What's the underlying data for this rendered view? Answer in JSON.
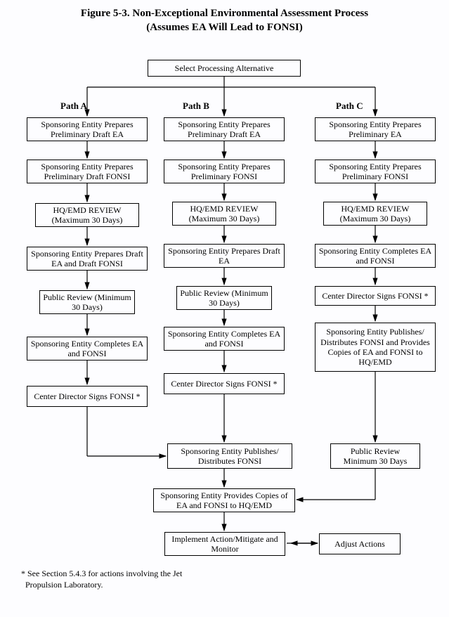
{
  "title_line1": "Figure 5-3.  Non-Exceptional Environmental Assessment Process",
  "title_line2": "(Assumes EA Will Lead to FONSI)",
  "top_box": "Select Processing Alternative",
  "pathA_label": "Path A",
  "pathB_label": "Path B",
  "pathC_label": "Path C",
  "A1": "Sponsoring Entity Prepares Preliminary Draft EA",
  "A2": "Sponsoring Entity Prepares Preliminary Draft FONSI",
  "A3": "HQ/EMD REVIEW (Maximum 30 Days)",
  "A4": "Sponsoring Entity Prepares Draft EA and Draft FONSI",
  "A5": "Public Review (Minimum 30 Days)",
  "A6": "Sponsoring Entity Completes EA and FONSI",
  "A7": "Center Director Signs FONSI *",
  "B1": "Sponsoring Entity Prepares Preliminary Draft EA",
  "B2": "Sponsoring Entity Prepares Preliminary FONSI",
  "B3": "HQ/EMD REVIEW (Maximum 30 Days)",
  "B4": "Sponsoring Entity Prepares Draft EA",
  "B5": "Public Review (Minimum 30 Days)",
  "B6": "Sponsoring Entity Completes EA and FONSI",
  "B7": "Center Director Signs FONSI *",
  "B8": "Sponsoring Entity Publishes/ Distributes FONSI",
  "B9": "Sponsoring Entity Provides Copies of EA and FONSI to HQ/EMD",
  "B10": "Implement Action/Mitigate and Monitor",
  "C1": "Sponsoring Entity Prepares Preliminary EA",
  "C2": "Sponsoring Entity Prepares Preliminary FONSI",
  "C3": "HQ/EMD REVIEW (Maximum 30 Days)",
  "C4": "Sponsoring Entity Completes EA and FONSI",
  "C5": "Center Director Signs FONSI *",
  "C6": "Sponsoring Entity Publishes/ Distributes FONSI and Provides Copies of EA and FONSI  to HQ/EMD",
  "C7": "Public Review Minimum 30 Days",
  "adjust": "Adjust Actions",
  "footnote_line1": "* See Section 5.4.3 for actions involving the Jet",
  "footnote_line2": "Propulsion Laboratory.",
  "chart_data": {
    "type": "flowchart",
    "title": "Non-Exceptional Environmental Assessment Process (Assumes EA Will Lead to FONSI)",
    "start": "Select Processing Alternative",
    "paths": {
      "Path A": [
        "Sponsoring Entity Prepares Preliminary Draft EA",
        "Sponsoring Entity Prepares Preliminary Draft FONSI",
        "HQ/EMD REVIEW (Maximum 30 Days)",
        "Sponsoring Entity Prepares Draft EA and Draft FONSI",
        "Public Review (Minimum 30 Days)",
        "Sponsoring Entity Completes EA and FONSI",
        "Center Director Signs FONSI *"
      ],
      "Path B": [
        "Sponsoring Entity Prepares Preliminary Draft EA",
        "Sponsoring Entity Prepares Preliminary FONSI",
        "HQ/EMD REVIEW (Maximum 30 Days)",
        "Sponsoring Entity Prepares Draft EA",
        "Public Review (Minimum 30 Days)",
        "Sponsoring Entity Completes EA and FONSI",
        "Center Director Signs FONSI *",
        "Sponsoring Entity Publishes/Distributes FONSI",
        "Sponsoring Entity Provides Copies of EA and FONSI to HQ/EMD",
        "Implement Action/Mitigate and Monitor"
      ],
      "Path C": [
        "Sponsoring Entity Prepares Preliminary EA",
        "Sponsoring Entity Prepares Preliminary FONSI",
        "HQ/EMD REVIEW (Maximum 30 Days)",
        "Sponsoring Entity Completes EA and FONSI",
        "Center Director Signs FONSI *",
        "Sponsoring Entity Publishes/Distributes FONSI and Provides Copies of EA and FONSI to HQ/EMD",
        "Public Review Minimum 30 Days"
      ]
    },
    "merges": [
      {
        "from": [
          "Path A last box",
          "Path B Center Director Signs FONSI *"
        ],
        "to": "Sponsoring Entity Publishes/Distributes FONSI"
      },
      {
        "from": [
          "Sponsoring Entity Publishes/Distributes FONSI",
          "Path C Public Review Minimum 30 Days"
        ],
        "to": "Sponsoring Entity Provides Copies of EA and FONSI to HQ/EMD"
      }
    ],
    "side_link": {
      "between": [
        "Implement Action/Mitigate and Monitor",
        "Adjust Actions"
      ],
      "bidirectional": true
    },
    "footnote": "* See Section 5.4.3 for actions involving the Jet Propulsion Laboratory."
  }
}
